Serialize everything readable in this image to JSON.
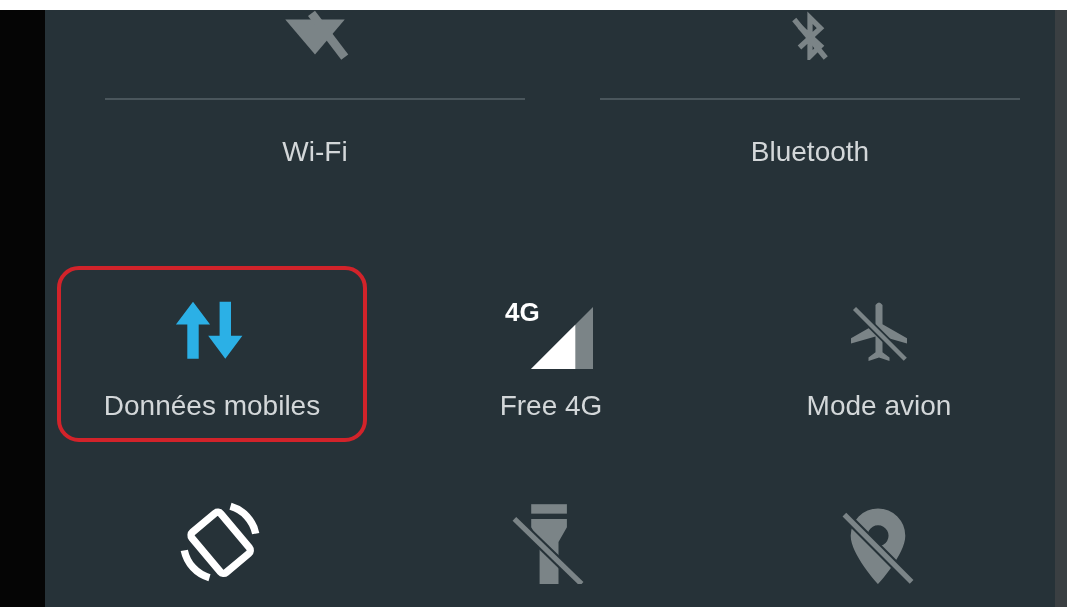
{
  "top_tiles": [
    {
      "kind": "wifi",
      "label": "Wi-Fi",
      "on": false
    },
    {
      "kind": "bluetooth",
      "label": "Bluetooth",
      "on": false
    }
  ],
  "tiles": [
    {
      "kind": "data",
      "label": "Données mobiles",
      "on": true,
      "highlighted": true
    },
    {
      "kind": "signal",
      "label": "Free 4G",
      "network": "4G",
      "on": true,
      "highlighted": false
    },
    {
      "kind": "airplane",
      "label": "Mode avion",
      "on": false,
      "highlighted": false
    }
  ],
  "bottom_tiles": [
    {
      "kind": "rotation",
      "on": true
    },
    {
      "kind": "flashlight",
      "on": false
    },
    {
      "kind": "location",
      "on": false
    }
  ]
}
